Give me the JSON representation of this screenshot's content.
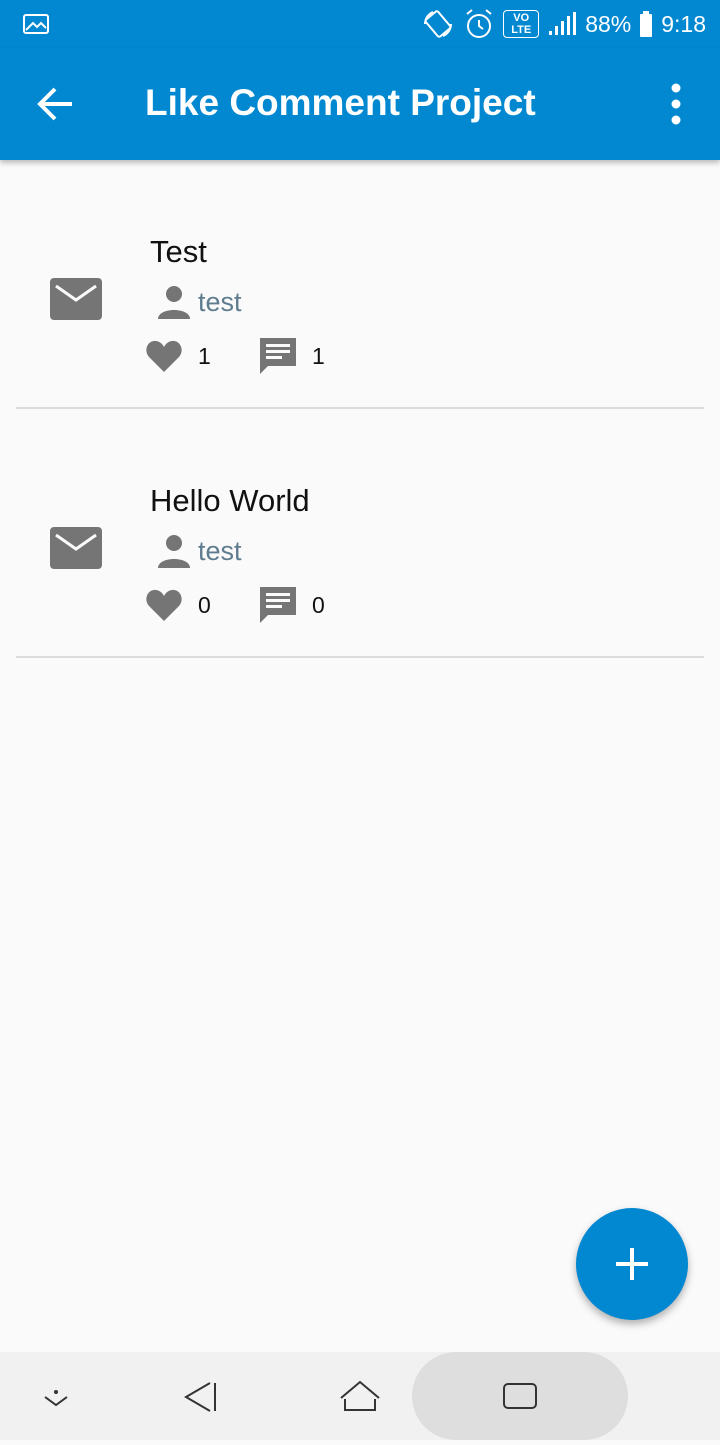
{
  "status_bar": {
    "battery": "88%",
    "time": "9:18",
    "network_badge": "VO LTE"
  },
  "app_bar": {
    "title": "Like Comment Project"
  },
  "posts": [
    {
      "title": "Test",
      "author": "test",
      "likes": "1",
      "comments": "1"
    },
    {
      "title": "Hello World",
      "author": "test",
      "likes": "0",
      "comments": "0"
    }
  ],
  "icons": {
    "post": "mail-icon",
    "author": "person-icon",
    "likes": "heart-icon",
    "comments": "comment-icon",
    "fab": "plus-icon"
  },
  "colors": {
    "primary": "#0288d1",
    "icon_gray": "#757575",
    "author_text": "#5e7c8e",
    "background": "#fafafa"
  }
}
